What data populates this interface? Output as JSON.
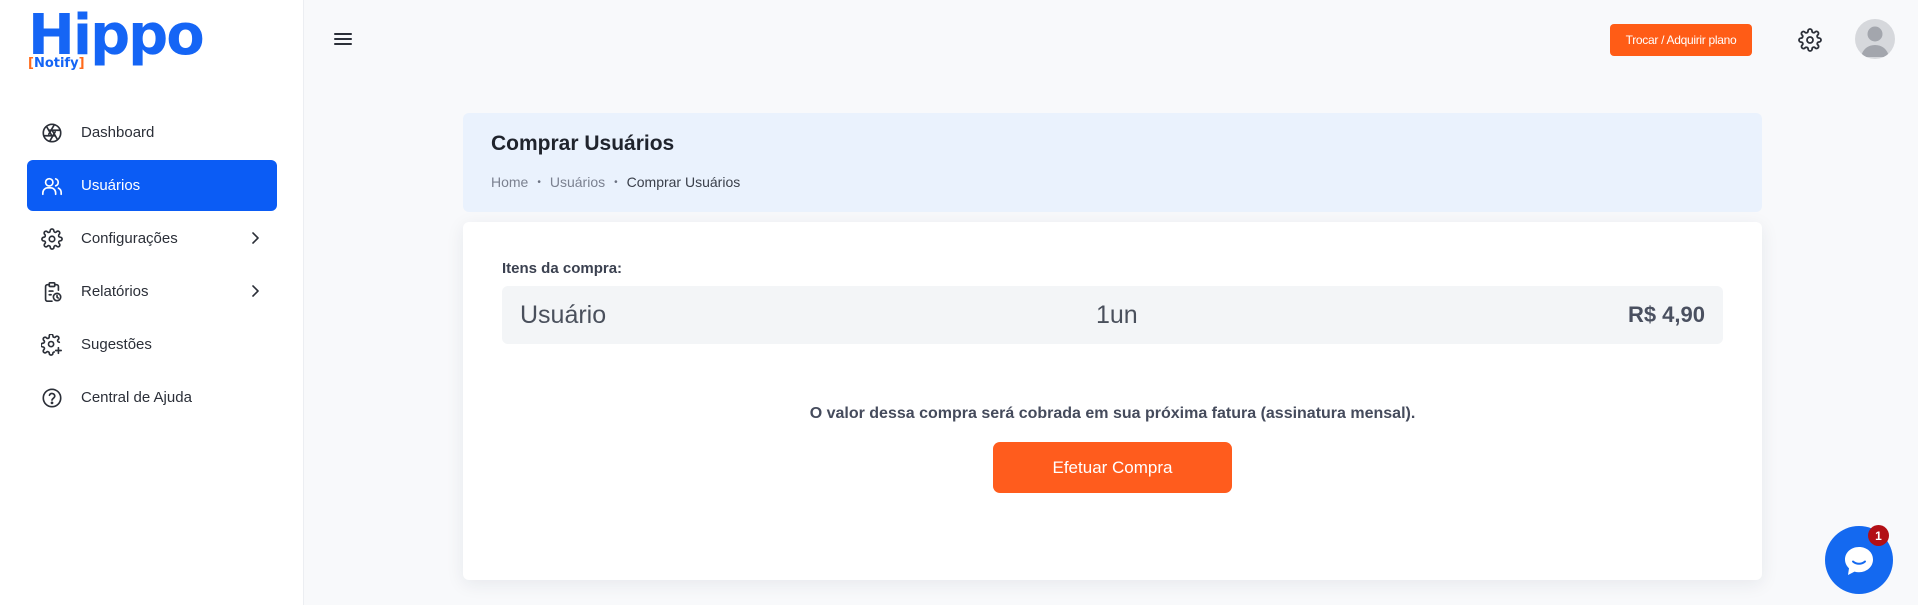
{
  "brand": {
    "logo_text": "Hippo",
    "logo_sub": "Notify"
  },
  "sidebar": {
    "items": [
      {
        "label": "Dashboard",
        "icon": "aperture-icon",
        "active": false,
        "has_submenu": false
      },
      {
        "label": "Usuários",
        "icon": "users-icon",
        "active": true,
        "has_submenu": false
      },
      {
        "label": "Configurações",
        "icon": "gear-icon",
        "active": false,
        "has_submenu": true
      },
      {
        "label": "Relatórios",
        "icon": "clipboard-clock-icon",
        "active": false,
        "has_submenu": true
      },
      {
        "label": "Sugestões",
        "icon": "gear-plus-icon",
        "active": false,
        "has_submenu": false
      },
      {
        "label": "Central de Ajuda",
        "icon": "help-circle-icon",
        "active": false,
        "has_submenu": false
      }
    ]
  },
  "topbar": {
    "plan_button": "Trocar / Adquirir plano"
  },
  "header": {
    "title": "Comprar Usuários",
    "breadcrumb": [
      "Home",
      "Usuários",
      "Comprar Usuários"
    ]
  },
  "purchase": {
    "items_label": "Itens da compra:",
    "item": {
      "name": "Usuário",
      "quantity": "1un",
      "price": "R$ 4,90"
    },
    "note": "O valor dessa compra será cobrada em sua próxima fatura (assinatura mensal).",
    "button": "Efetuar Compra"
  },
  "chat": {
    "badge": "1"
  },
  "colors": {
    "primary": "#0b5cf5",
    "accent": "#ff5c16",
    "header_bg": "#eaf2fd",
    "badge": "#b20f15"
  }
}
